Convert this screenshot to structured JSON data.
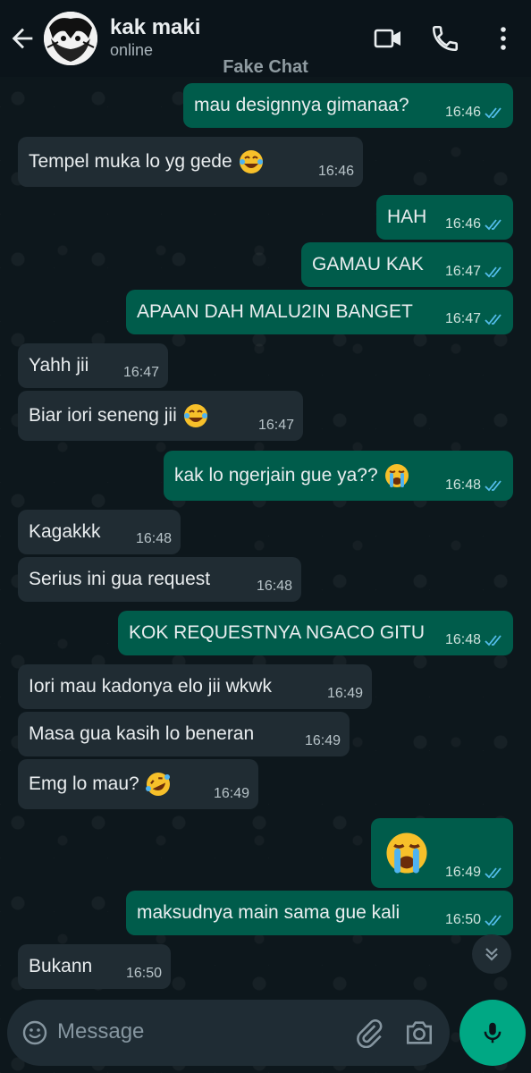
{
  "header": {
    "contact_name": "kak maki",
    "status": "online",
    "watermark": "Fake Chat"
  },
  "messages": [
    {
      "dir": "out",
      "text": "mau designnya gimanaa?",
      "time": "16:46",
      "ticks": "read"
    },
    {
      "dir": "in",
      "text": "Tempel muka lo yg gede",
      "emoji": "face-with-tears-of-joy",
      "time": "16:46"
    },
    {
      "dir": "out",
      "text": "HAH",
      "time": "16:46",
      "ticks": "read"
    },
    {
      "dir": "out",
      "text": "GAMAU KAK",
      "time": "16:47",
      "ticks": "read"
    },
    {
      "dir": "out",
      "text": "APAAN DAH MALU2IN BANGET",
      "time": "16:47",
      "ticks": "read"
    },
    {
      "dir": "in",
      "text": "Yahh jii",
      "time": "16:47"
    },
    {
      "dir": "in",
      "text": "Biar iori seneng jii",
      "emoji": "face-with-tears-of-joy",
      "time": "16:47"
    },
    {
      "dir": "out",
      "text": "kak lo ngerjain gue ya??",
      "emoji": "loudly-crying-face",
      "time": "16:48",
      "ticks": "read"
    },
    {
      "dir": "in",
      "text": "Kagakkk",
      "time": "16:48"
    },
    {
      "dir": "in",
      "text": "Serius ini gua request",
      "time": "16:48"
    },
    {
      "dir": "out",
      "text": "KOK REQUESTNYA NGACO GITU",
      "time": "16:48",
      "ticks": "read"
    },
    {
      "dir": "in",
      "text": "Iori mau kadonya elo jii wkwk",
      "time": "16:49"
    },
    {
      "dir": "in",
      "text": "Masa gua kasih lo beneran",
      "time": "16:49"
    },
    {
      "dir": "in",
      "text": "Emg lo mau?",
      "emoji": "rolling-on-the-floor-laughing",
      "time": "16:49"
    },
    {
      "dir": "out",
      "text": "",
      "emoji": "loudly-crying-face",
      "time": "16:49",
      "ticks": "read"
    },
    {
      "dir": "out",
      "text": "maksudnya main sama gue kali",
      "time": "16:50",
      "ticks": "read"
    },
    {
      "dir": "in",
      "text": "Bukann",
      "time": "16:50"
    }
  ],
  "composer": {
    "placeholder": "Message"
  },
  "colors": {
    "incoming_bubble": "#202c33",
    "outgoing_bubble": "#005c4b",
    "read_ticks": "#53bdeb",
    "accent": "#00a884"
  }
}
